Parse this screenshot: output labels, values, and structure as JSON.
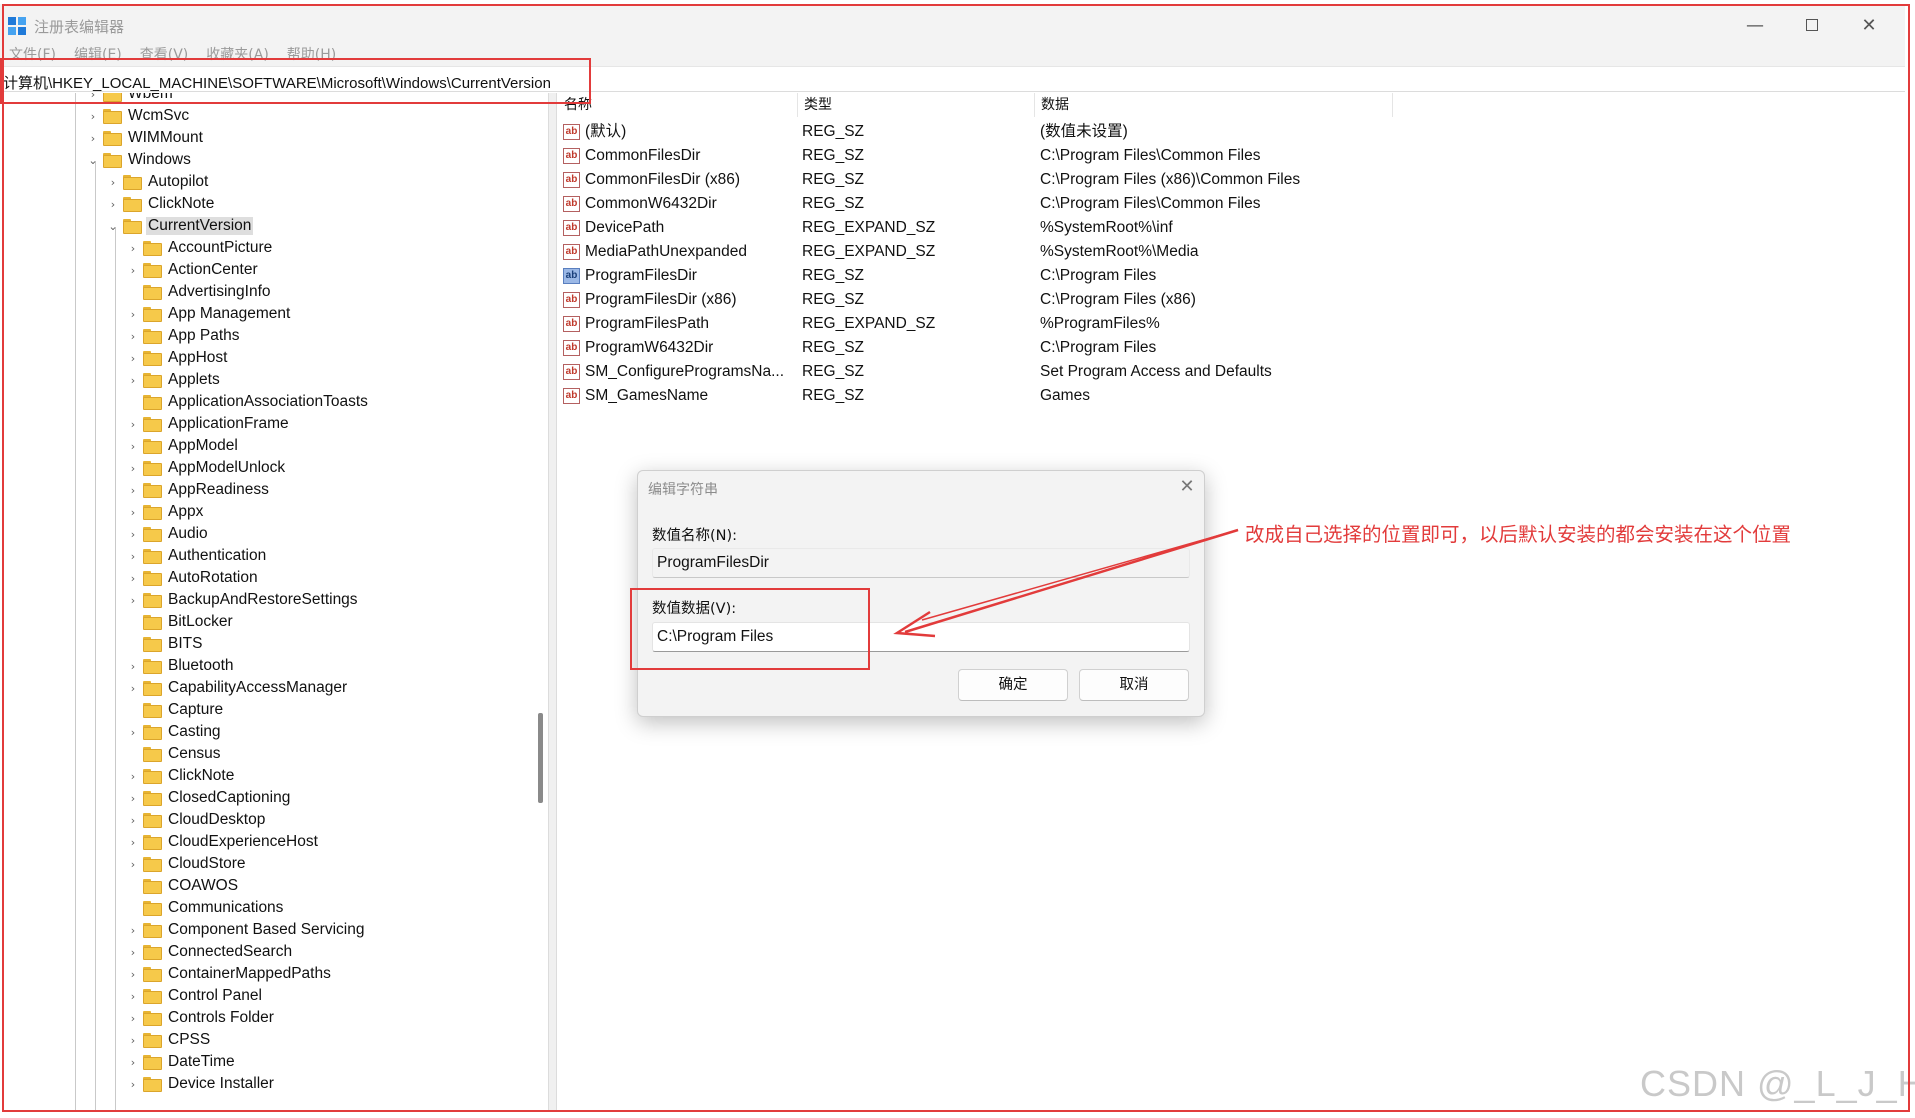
{
  "window": {
    "title": "注册表编辑器",
    "minimize_glyph": "—",
    "close_glyph": "✕"
  },
  "menu": [
    "文件(F)",
    "编辑(E)",
    "查看(V)",
    "收藏夹(A)",
    "帮助(H)"
  ],
  "address_path": "计算机\\HKEY_LOCAL_MACHINE\\SOFTWARE\\Microsoft\\Windows\\CurrentVersion",
  "tree": {
    "parents": [
      {
        "label": "Wbem",
        "expanded": false
      },
      {
        "label": "WcmSvc",
        "expanded": false
      },
      {
        "label": "WIMMount",
        "expanded": false
      },
      {
        "label": "Windows",
        "expanded": true
      }
    ],
    "windows_children": [
      {
        "label": "Autopilot",
        "expanded": false
      },
      {
        "label": "ClickNote",
        "expanded": false
      },
      {
        "label": "CurrentVersion",
        "expanded": true,
        "selected": true
      }
    ],
    "currentversion_children": [
      {
        "label": "AccountPicture",
        "has_children": true
      },
      {
        "label": "ActionCenter",
        "has_children": true
      },
      {
        "label": "AdvertisingInfo",
        "has_children": false
      },
      {
        "label": "App Management",
        "has_children": true
      },
      {
        "label": "App Paths",
        "has_children": true
      },
      {
        "label": "AppHost",
        "has_children": true
      },
      {
        "label": "Applets",
        "has_children": true
      },
      {
        "label": "ApplicationAssociationToasts",
        "has_children": false
      },
      {
        "label": "ApplicationFrame",
        "has_children": true
      },
      {
        "label": "AppModel",
        "has_children": true
      },
      {
        "label": "AppModelUnlock",
        "has_children": true
      },
      {
        "label": "AppReadiness",
        "has_children": true
      },
      {
        "label": "Appx",
        "has_children": true
      },
      {
        "label": "Audio",
        "has_children": true
      },
      {
        "label": "Authentication",
        "has_children": true
      },
      {
        "label": "AutoRotation",
        "has_children": true
      },
      {
        "label": "BackupAndRestoreSettings",
        "has_children": true
      },
      {
        "label": "BitLocker",
        "has_children": false
      },
      {
        "label": "BITS",
        "has_children": false
      },
      {
        "label": "Bluetooth",
        "has_children": true
      },
      {
        "label": "CapabilityAccessManager",
        "has_children": true
      },
      {
        "label": "Capture",
        "has_children": false
      },
      {
        "label": "Casting",
        "has_children": true
      },
      {
        "label": "Census",
        "has_children": false
      },
      {
        "label": "ClickNote",
        "has_children": true
      },
      {
        "label": "ClosedCaptioning",
        "has_children": true
      },
      {
        "label": "CloudDesktop",
        "has_children": true
      },
      {
        "label": "CloudExperienceHost",
        "has_children": true
      },
      {
        "label": "CloudStore",
        "has_children": true
      },
      {
        "label": "COAWOS",
        "has_children": false
      },
      {
        "label": "Communications",
        "has_children": false
      },
      {
        "label": "Component Based Servicing",
        "has_children": true
      },
      {
        "label": "ConnectedSearch",
        "has_children": true
      },
      {
        "label": "ContainerMappedPaths",
        "has_children": true
      },
      {
        "label": "Control Panel",
        "has_children": true
      },
      {
        "label": "Controls Folder",
        "has_children": true
      },
      {
        "label": "CPSS",
        "has_children": true
      },
      {
        "label": "DateTime",
        "has_children": true
      },
      {
        "label": "Device Installer",
        "has_children": true
      }
    ]
  },
  "values_table": {
    "headers": [
      "名称",
      "类型",
      "数据"
    ],
    "rows": [
      {
        "name": "(默认)",
        "type": "REG_SZ",
        "data": "(数值未设置)",
        "icon": "string-value-icon"
      },
      {
        "name": "CommonFilesDir",
        "type": "REG_SZ",
        "data": "C:\\Program Files\\Common Files",
        "icon": "string-value-icon"
      },
      {
        "name": "CommonFilesDir (x86)",
        "type": "REG_SZ",
        "data": "C:\\Program Files (x86)\\Common Files",
        "icon": "string-value-icon"
      },
      {
        "name": "CommonW6432Dir",
        "type": "REG_SZ",
        "data": "C:\\Program Files\\Common Files",
        "icon": "string-value-icon"
      },
      {
        "name": "DevicePath",
        "type": "REG_EXPAND_SZ",
        "data": "%SystemRoot%\\inf",
        "icon": "string-value-icon"
      },
      {
        "name": "MediaPathUnexpanded",
        "type": "REG_EXPAND_SZ",
        "data": "%SystemRoot%\\Media",
        "icon": "string-value-icon"
      },
      {
        "name": "ProgramFilesDir",
        "type": "REG_SZ",
        "data": "C:\\Program Files",
        "icon": "string-value-icon",
        "selected": true
      },
      {
        "name": "ProgramFilesDir (x86)",
        "type": "REG_SZ",
        "data": "C:\\Program Files (x86)",
        "icon": "string-value-icon"
      },
      {
        "name": "ProgramFilesPath",
        "type": "REG_EXPAND_SZ",
        "data": "%ProgramFiles%",
        "icon": "string-value-icon"
      },
      {
        "name": "ProgramW6432Dir",
        "type": "REG_SZ",
        "data": "C:\\Program Files",
        "icon": "string-value-icon"
      },
      {
        "name": "SM_ConfigureProgramsNa...",
        "type": "REG_SZ",
        "data": "Set Program Access and Defaults",
        "icon": "string-value-icon"
      },
      {
        "name": "SM_GamesName",
        "type": "REG_SZ",
        "data": "Games",
        "icon": "string-value-icon"
      }
    ]
  },
  "dialog": {
    "title": "编辑字符串",
    "name_label": "数值名称(N):",
    "name_value": "ProgramFilesDir",
    "data_label": "数值数据(V):",
    "data_value": "C:\\Program Files",
    "ok_label": "确定",
    "cancel_label": "取消",
    "close_glyph": "✕"
  },
  "annotation": {
    "text": "改成自己选择的位置即可，以后默认安装的都会安装在这个位置",
    "color": "#e23b3b"
  },
  "watermark": "CSDN @_L_J_H_"
}
